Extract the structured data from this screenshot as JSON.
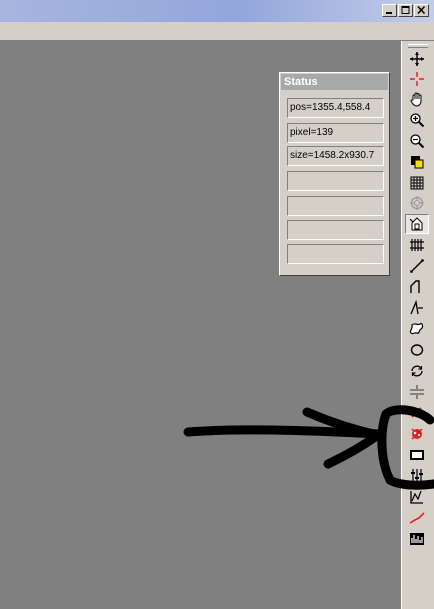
{
  "window": {
    "controls": [
      "minimize-icon",
      "maximize-icon",
      "close-icon"
    ]
  },
  "status_panel": {
    "title": "Status",
    "fields": [
      "pos=1355.4,558.4",
      "pixel=139",
      "size=1458.2x930.7",
      "",
      "",
      "",
      ""
    ]
  },
  "toolbar": {
    "tools": [
      {
        "name": "move-icon"
      },
      {
        "name": "crosshair-icon"
      },
      {
        "name": "pan-hand-icon"
      },
      {
        "name": "zoom-in-icon"
      },
      {
        "name": "zoom-out-icon"
      },
      {
        "name": "color-picker-icon"
      },
      {
        "name": "grid-icon"
      },
      {
        "name": "target-icon"
      },
      {
        "name": "select-region-icon",
        "active": true
      },
      {
        "name": "grid-lines-icon"
      },
      {
        "name": "line-icon"
      },
      {
        "name": "polyline-icon"
      },
      {
        "name": "angle-icon"
      },
      {
        "name": "freehand-region-icon"
      },
      {
        "name": "ellipse-icon"
      },
      {
        "name": "rotate-icon"
      },
      {
        "name": "divide-icon"
      },
      {
        "name": "delete-x-icon"
      },
      {
        "name": "splat-icon"
      },
      {
        "name": "display-icon"
      },
      {
        "name": "adjust-sliders-icon"
      },
      {
        "name": "profile-icon"
      },
      {
        "name": "red-line-icon"
      },
      {
        "name": "histogram-icon"
      }
    ]
  },
  "annotation": {
    "color": "#000000"
  }
}
